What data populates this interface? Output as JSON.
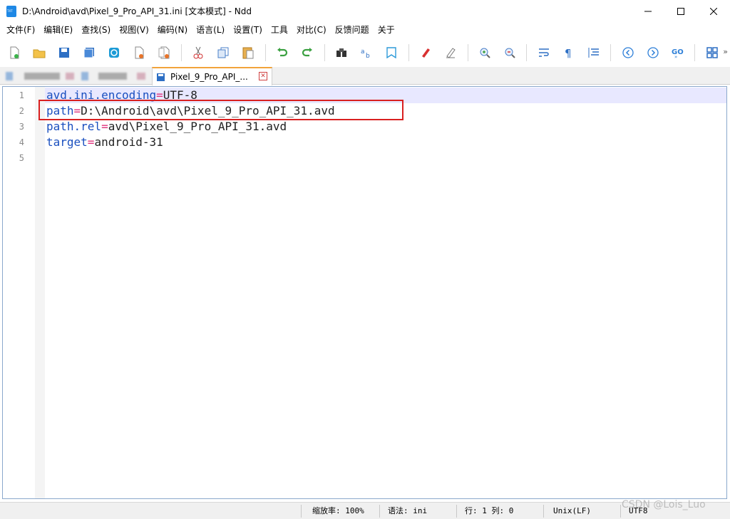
{
  "window": {
    "title": "D:\\Android\\avd\\Pixel_9_Pro_API_31.ini [文本模式] - Ndd",
    "minimize": "—",
    "maximize": "☐",
    "close": "✕"
  },
  "menu": [
    "文件(F)",
    "编辑(E)",
    "查找(S)",
    "视图(V)",
    "编码(N)",
    "语言(L)",
    "设置(T)",
    "工具",
    "对比(C)",
    "反馈问题",
    "关于"
  ],
  "toolbar": {
    "icons": [
      "new-file-icon",
      "open-file-icon",
      "save-icon",
      "save-all-icon",
      "reload-icon",
      "close-file-icon",
      "close-all-icon",
      "cut-icon",
      "copy-icon",
      "paste-icon",
      "undo-icon",
      "redo-icon",
      "find-icon",
      "replace-icon",
      "bookmark-icon",
      "mark-icon",
      "clear-mark-icon",
      "zoom-in-icon",
      "zoom-out-icon",
      "word-wrap-icon",
      "show-symbols-icon",
      "indent-guide-icon",
      "back-icon",
      "forward-icon",
      "goto-icon",
      "compare-icon"
    ],
    "more": "»"
  },
  "tabs": {
    "active_label": "Pixel_9_Pro_API_...",
    "close": "✕"
  },
  "editor": {
    "lines": [
      {
        "num": "1",
        "key": "avd.ini.encoding",
        "eq": "=",
        "val": "UTF-8"
      },
      {
        "num": "2",
        "key": "path",
        "eq": "=",
        "val": "D:\\Android\\avd\\Pixel_9_Pro_API_31.avd"
      },
      {
        "num": "3",
        "key": "path.rel",
        "eq": "=",
        "val": "avd\\Pixel_9_Pro_API_31.avd"
      },
      {
        "num": "4",
        "key": "target",
        "eq": "=",
        "val": "android-31"
      },
      {
        "num": "5",
        "key": "",
        "eq": "",
        "val": ""
      }
    ]
  },
  "status": {
    "zoom": "缩放率: 100%",
    "syntax": "语法: ini",
    "position": "行: 1 列: 0",
    "eol": "Unix(LF)",
    "encoding": "UTF8"
  },
  "watermark": "CSDN @Lois_Luo"
}
